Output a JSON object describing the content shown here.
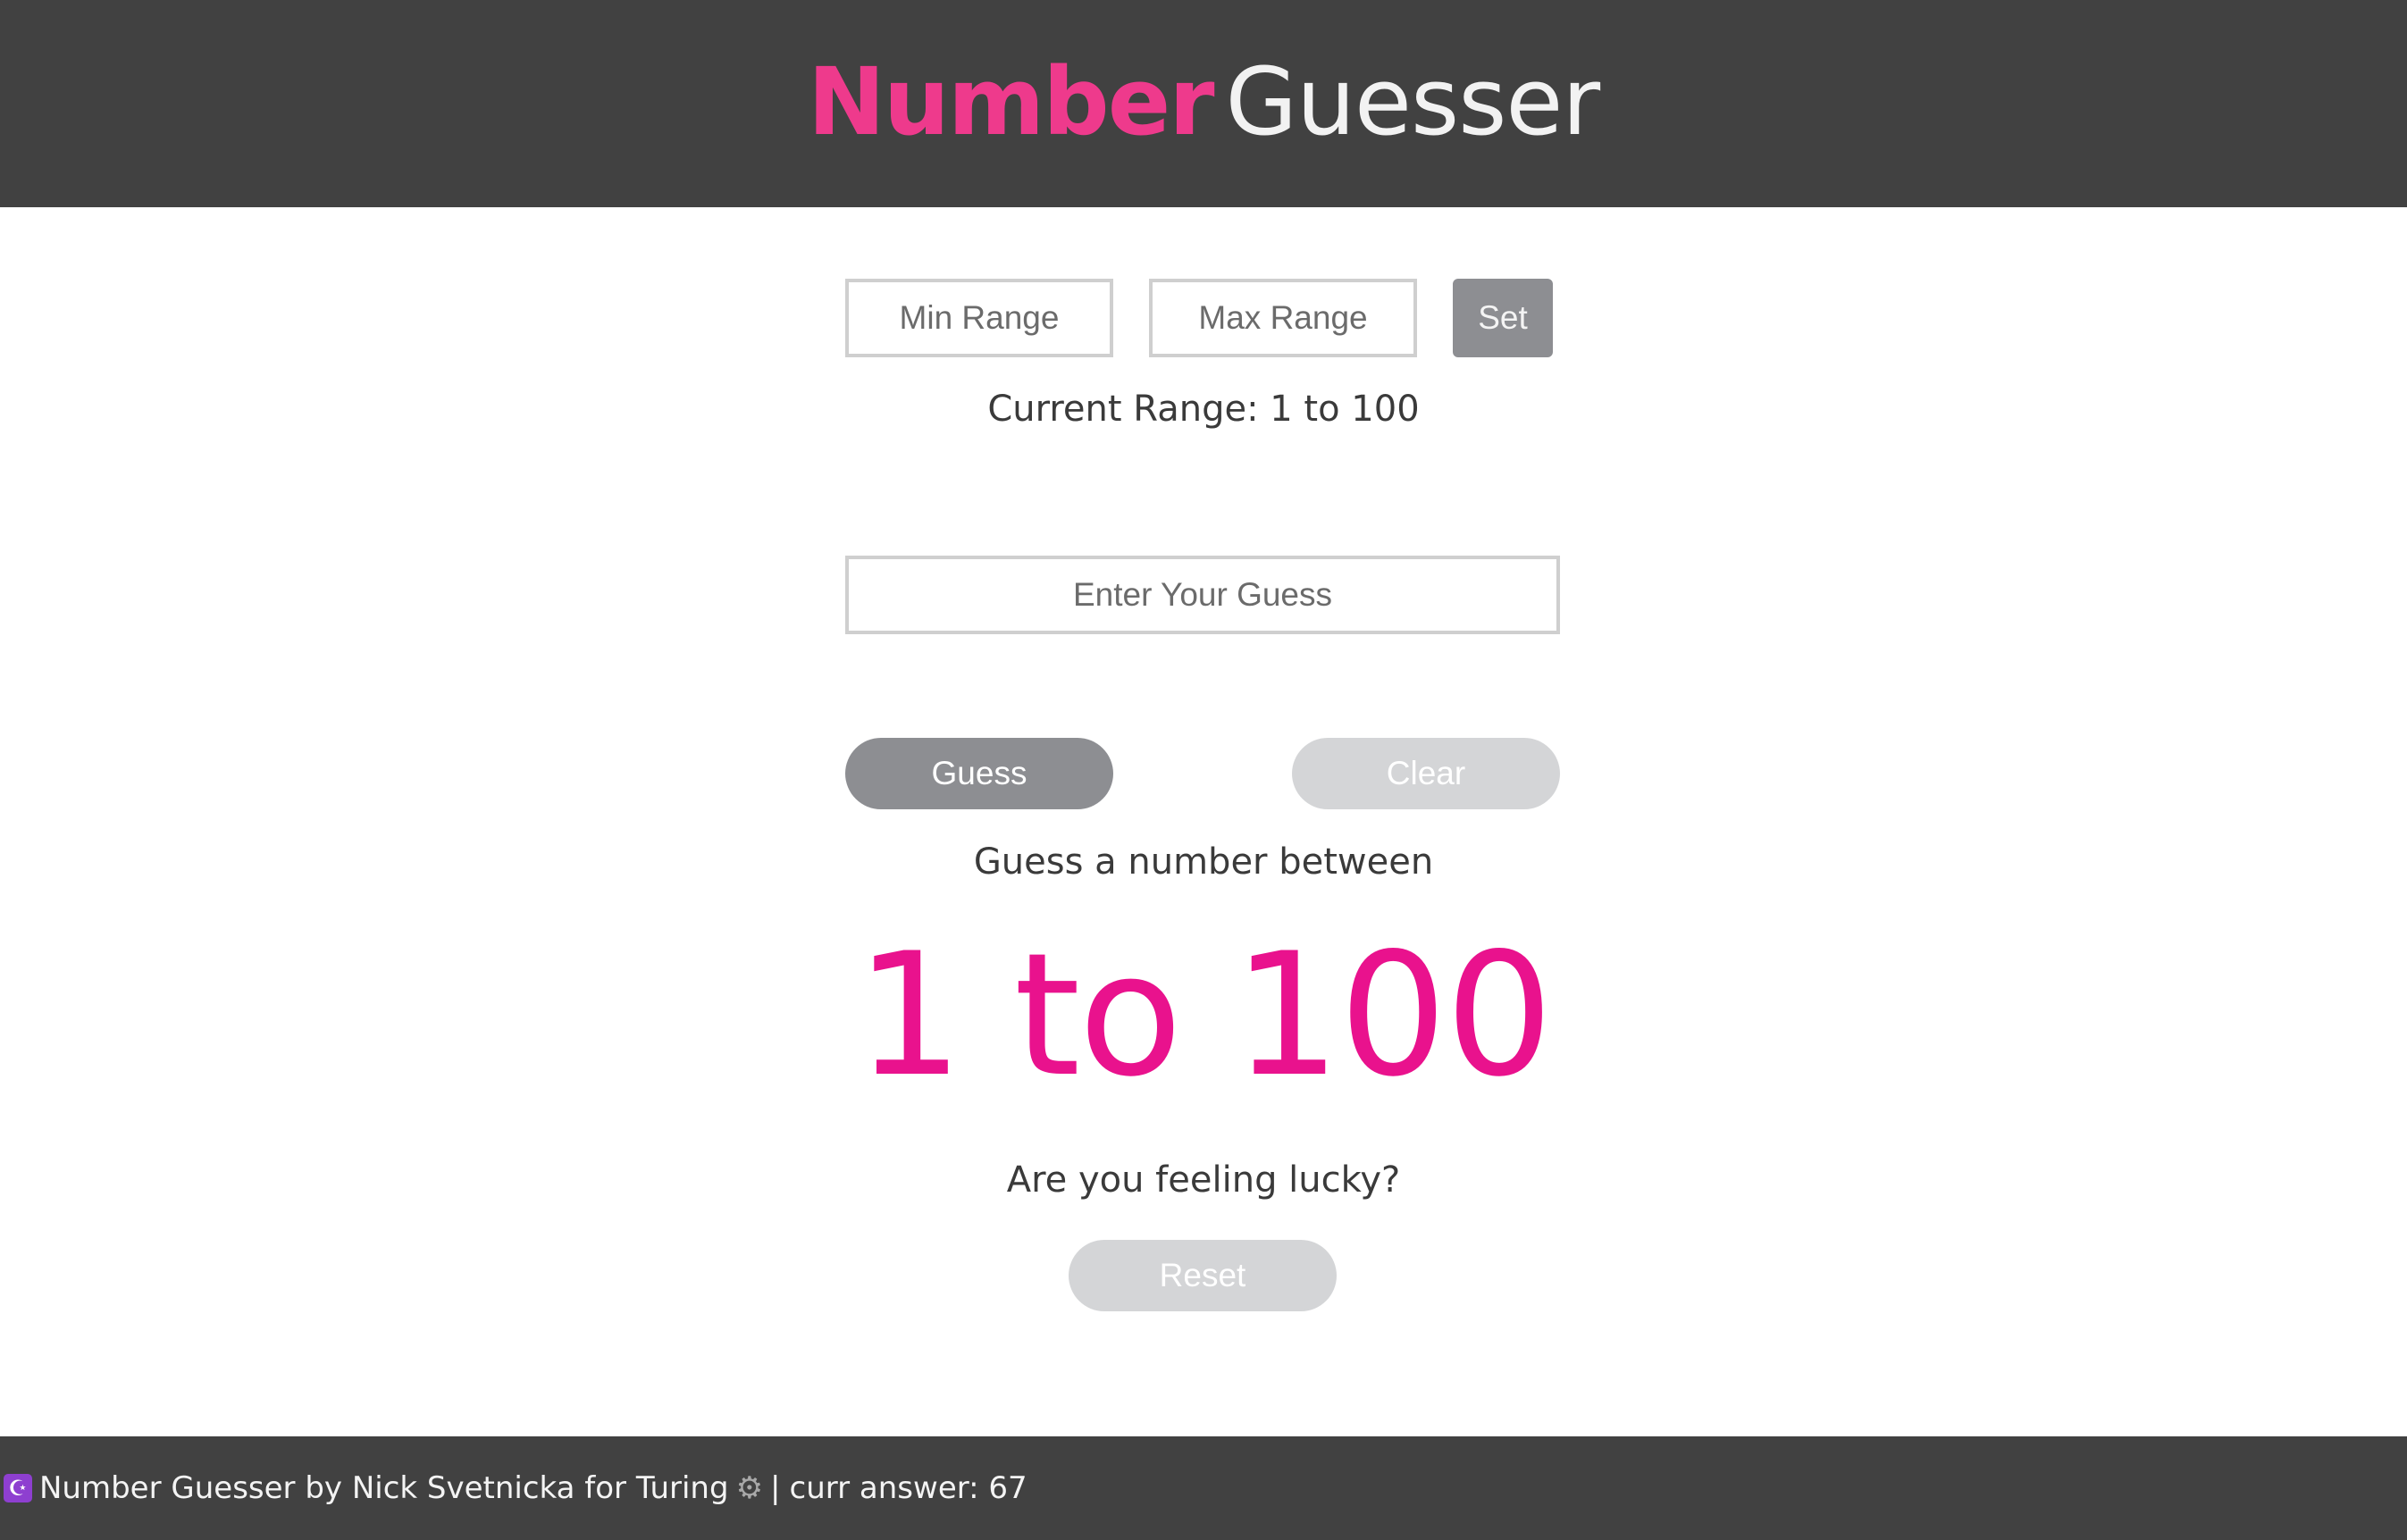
{
  "header": {
    "title_strong": "Number",
    "title_light": "Guesser"
  },
  "range_controls": {
    "min_placeholder": "Min Range",
    "max_placeholder": "Max Range",
    "set_label": "Set",
    "current_range": "Current Range: 1 to 100"
  },
  "guess": {
    "placeholder": "Enter Your Guess",
    "guess_label": "Guess",
    "clear_label": "Clear"
  },
  "feedback": {
    "prompt": "Guess a number between",
    "range_display": "1 to 100",
    "lucky": "Are you feeling lucky?",
    "reset_label": "Reset"
  },
  "footer": {
    "moon_icon": "☪",
    "credit": "Number Guesser by Nick Svetnicka for Turing",
    "gear_icon": "⚙",
    "separator": "|",
    "answer": "curr answer: 67"
  },
  "colors": {
    "header_bg": "#414141",
    "accent_pink": "#ee3a8c",
    "big_range_pink": "#e9128d",
    "active_button": "#8d8e92",
    "disabled_button": "#d4d5d7"
  },
  "icons": [
    "moon-icon",
    "gear-icon"
  ]
}
